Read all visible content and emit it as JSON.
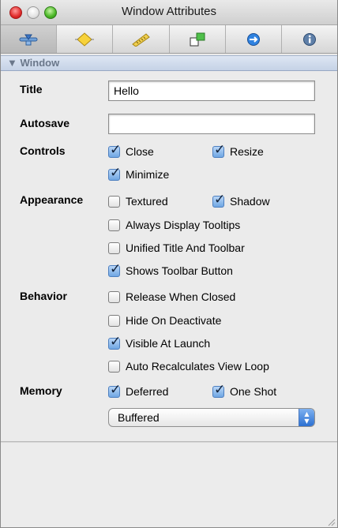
{
  "window": {
    "title": "Window Attributes"
  },
  "toolbar": {
    "buttons": [
      {
        "icon": "attributes-icon"
      },
      {
        "icon": "effects-icon"
      },
      {
        "icon": "size-ruler-icon"
      },
      {
        "icon": "connections-icon"
      },
      {
        "icon": "bindings-icon"
      },
      {
        "icon": "info-icon"
      }
    ],
    "selected_index": 0
  },
  "section": {
    "title": "Window"
  },
  "labels": {
    "title": "Title",
    "autosave": "Autosave",
    "controls": "Controls",
    "appearance": "Appearance",
    "behavior": "Behavior",
    "memory": "Memory"
  },
  "fields": {
    "title_value": "Hello",
    "autosave_value": ""
  },
  "checkboxes": {
    "close": {
      "label": "Close",
      "checked": true
    },
    "resize": {
      "label": "Resize",
      "checked": true
    },
    "minimize": {
      "label": "Minimize",
      "checked": true
    },
    "textured": {
      "label": "Textured",
      "checked": false
    },
    "shadow": {
      "label": "Shadow",
      "checked": true
    },
    "tooltips": {
      "label": "Always Display Tooltips",
      "checked": false
    },
    "unified": {
      "label": "Unified Title And Toolbar",
      "checked": false
    },
    "toolbar_button": {
      "label": "Shows Toolbar Button",
      "checked": true
    },
    "release": {
      "label": "Release When Closed",
      "checked": false
    },
    "hide": {
      "label": "Hide On Deactivate",
      "checked": false
    },
    "visible": {
      "label": "Visible At Launch",
      "checked": true
    },
    "recalc": {
      "label": "Auto Recalculates View Loop",
      "checked": false
    },
    "deferred": {
      "label": "Deferred",
      "checked": true
    },
    "oneshot": {
      "label": "One Shot",
      "checked": true
    }
  },
  "memory": {
    "backing_selected": "Buffered"
  },
  "colors": {
    "accent": "#2b6fd1",
    "section_header": "#c5d2e6",
    "check_fill": "#6fa6e3"
  }
}
